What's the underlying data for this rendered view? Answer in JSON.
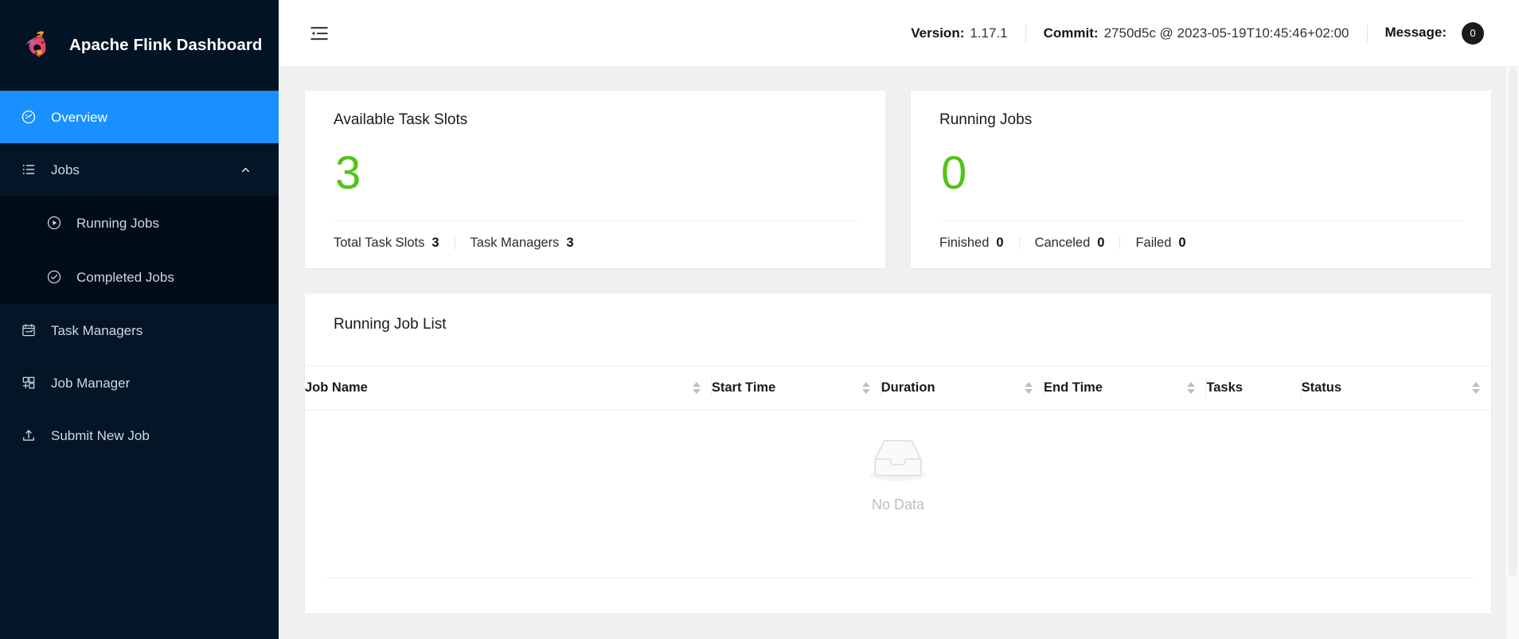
{
  "brand": {
    "title": "Apache Flink Dashboard",
    "logo_icon": "flink-squirrel-logo"
  },
  "sidebar": {
    "items": [
      {
        "label": "Overview",
        "icon": "dashboard-gauge-icon",
        "active": true
      },
      {
        "label": "Jobs",
        "icon": "list-icon",
        "expanded": true,
        "chevron": "chevron-up-icon"
      },
      {
        "label": "Running Jobs",
        "icon": "play-circle-icon",
        "sub": true
      },
      {
        "label": "Completed Jobs",
        "icon": "check-circle-icon",
        "sub": true
      },
      {
        "label": "Task Managers",
        "icon": "calendar-check-icon"
      },
      {
        "label": "Job Manager",
        "icon": "layout-grid-icon"
      },
      {
        "label": "Submit New Job",
        "icon": "upload-icon"
      }
    ]
  },
  "topbar": {
    "fold_icon": "menu-fold-icon",
    "version_label": "Version:",
    "version_value": "1.17.1",
    "commit_label": "Commit:",
    "commit_value": "2750d5c @ 2023-05-19T10:45:46+02:00",
    "message_label": "Message:",
    "message_count": "0"
  },
  "cards": {
    "task_slots": {
      "title": "Available Task Slots",
      "value": "3",
      "stats": [
        {
          "label": "Total Task Slots",
          "value": "3"
        },
        {
          "label": "Task Managers",
          "value": "3"
        }
      ]
    },
    "running_jobs": {
      "title": "Running Jobs",
      "value": "0",
      "stats": [
        {
          "label": "Finished",
          "value": "0"
        },
        {
          "label": "Canceled",
          "value": "0"
        },
        {
          "label": "Failed",
          "value": "0"
        }
      ]
    }
  },
  "job_list": {
    "title": "Running Job List",
    "columns": [
      {
        "label": "Job Name",
        "sortable": true
      },
      {
        "label": "Start Time",
        "sortable": true
      },
      {
        "label": "Duration",
        "sortable": true
      },
      {
        "label": "End Time",
        "sortable": true
      },
      {
        "label": "Tasks",
        "sortable": false
      },
      {
        "label": "Status",
        "sortable": true
      }
    ],
    "rows": [],
    "empty_text": "No Data",
    "empty_icon": "empty-box-icon"
  },
  "colors": {
    "sidebar_bg": "#031527",
    "submenu_bg": "#000c17",
    "active_blue": "#1890ff",
    "stat_green": "#52c41a",
    "page_bg": "#f0f0f0"
  }
}
